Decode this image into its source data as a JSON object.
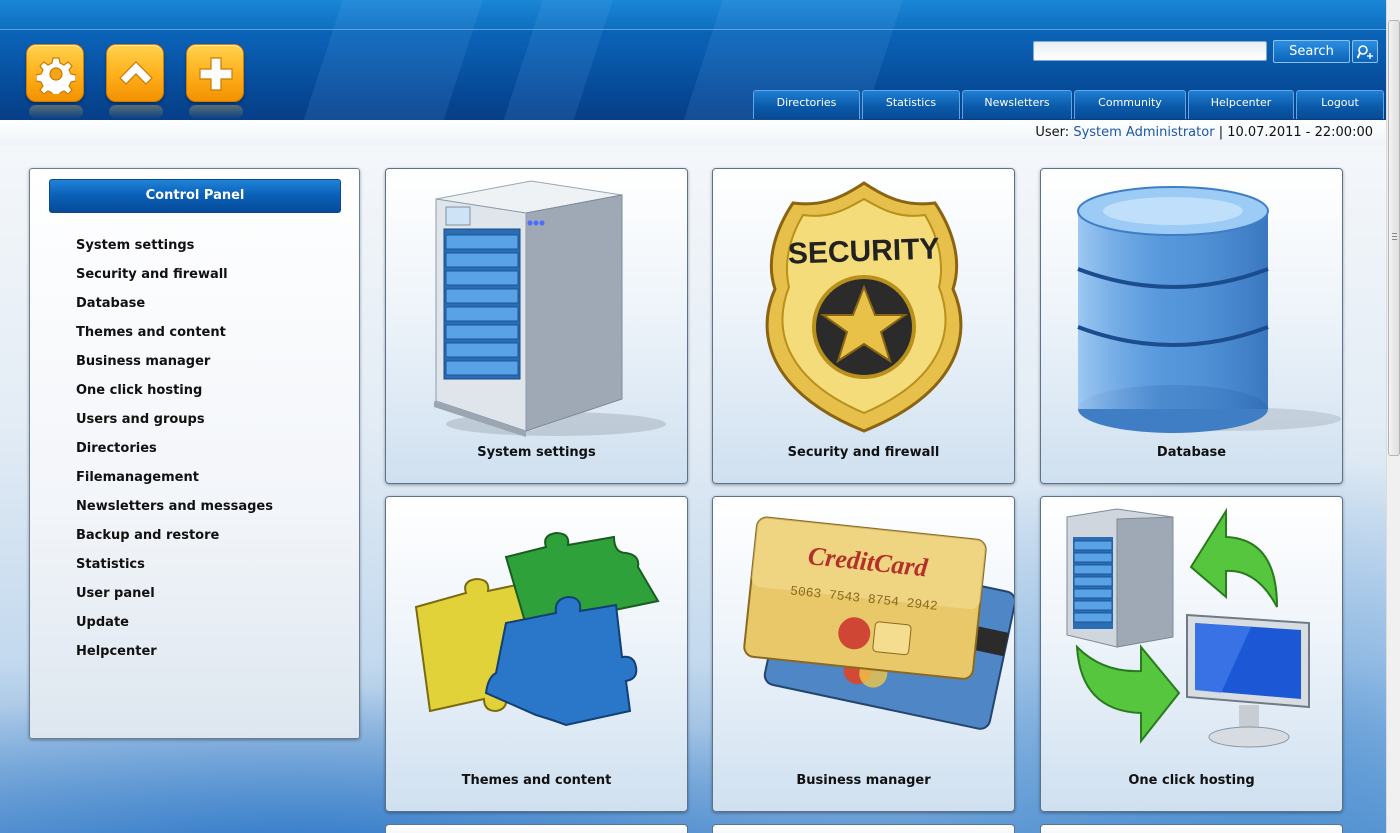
{
  "header": {
    "quick_buttons": [
      {
        "icon": "gear-icon"
      },
      {
        "icon": "home-icon"
      },
      {
        "icon": "plus-icon"
      }
    ],
    "search": {
      "placeholder": "",
      "value": "",
      "button_label": "Search",
      "advanced_icon": "search-plus-icon"
    },
    "nav_tabs": [
      "Directories",
      "Statistics",
      "Newsletters",
      "Community",
      "Helpcenter",
      "Logout"
    ]
  },
  "userbar": {
    "user_prefix": "User:",
    "user_name": "System Administrator",
    "separator": "|",
    "datetime": "10.07.2011 - 22:00:00"
  },
  "sidebar": {
    "title": "Control Panel",
    "items": [
      "System settings",
      "Security and firewall",
      "Database",
      "Themes and content",
      "Business manager",
      "One click hosting",
      "Users and groups",
      "Directories",
      "Filemanagement",
      "Newsletters and messages",
      "Backup and restore",
      "Statistics",
      "User panel",
      "Update",
      "Helpcenter"
    ]
  },
  "tiles": [
    {
      "label": "System settings",
      "icon": "server-icon"
    },
    {
      "label": "Security and firewall",
      "icon": "security-badge-icon",
      "badge_text": "SECURITY"
    },
    {
      "label": "Database",
      "icon": "database-icon"
    },
    {
      "label": "Themes and content",
      "icon": "puzzle-icon"
    },
    {
      "label": "Business manager",
      "icon": "credit-card-icon",
      "card_text": "CreditCard",
      "card_number": "5063 7543 8754 2942"
    },
    {
      "label": "One click hosting",
      "icon": "hosting-sync-icon"
    }
  ],
  "colors": {
    "header_blue": "#0a5db0",
    "accent_orange": "#ffae1a",
    "user_link": "#1b57a6"
  }
}
